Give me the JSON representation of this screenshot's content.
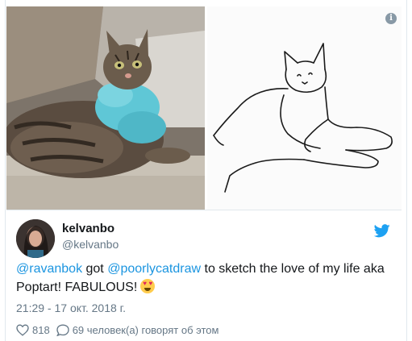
{
  "author": {
    "name": "kelvanbo",
    "handle": "@kelvanbo"
  },
  "tweet": {
    "mention_1": "@ravanbok",
    "text_1": " got ",
    "mention_2": "@poorlycatdraw",
    "text_2": " to sketch the love of my life aka Poptart! FABULOUS!",
    "emoji": "heart-eyes-emoji"
  },
  "timestamp": "21:29 - 17 окт. 2018 г.",
  "stats": {
    "likes": "818",
    "comments": "69 человек(а) говорят об этом"
  },
  "icons": {
    "info": "i",
    "twitter_color": "#1da1f2",
    "accent": "#1b95e0"
  }
}
